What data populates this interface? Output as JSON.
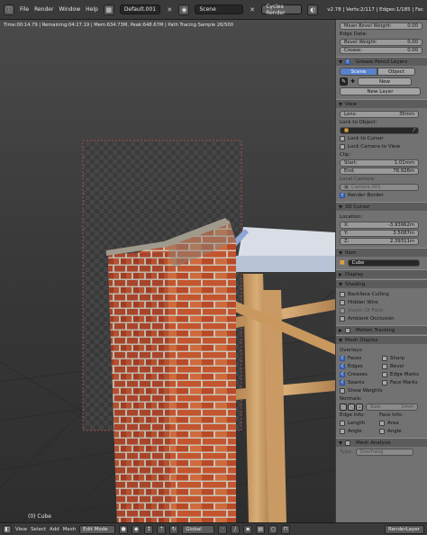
{
  "topbar": {
    "menus": [
      "File",
      "Render",
      "Window",
      "Help"
    ],
    "screen_layout": "Default.001",
    "scene": "Scene",
    "render_engine": "Cycles Render",
    "stats": "v2.78 | Verts:2/117 | Edges:1/185 | Fac"
  },
  "viewport": {
    "status_line": "Time:00:14.79 | Remaining:04:27.19 | Mem:634.73M, Peak:648.67M | Path Tracing Sample 26/500",
    "object_name": "(0) Cube"
  },
  "sidebar": {
    "mean_bevel_weight": "Mean Bevel Weight:",
    "mean_bevel_weight_val": "0.00",
    "edge_data": "Edge Data:",
    "bevel_weight": "Bevel Weight:",
    "bevel_weight_val": "0.00",
    "crease": "Crease:",
    "crease_val": "0.00",
    "grease_pencil": {
      "title": "Grease Pencil Layers",
      "tab_scene": "Scene",
      "tab_object": "Object",
      "new_label": "New",
      "new_layer": "New Layer"
    },
    "view": {
      "title": "View",
      "lens_label": "Lens:",
      "lens_value": "35mm",
      "lock_to_object": "Lock to Object:",
      "lock_to_cursor": "Lock to Cursor",
      "lock_camera": "Lock Camera to View",
      "clip": "Clip:",
      "start_label": "Start:",
      "start_value": "1.01mm",
      "end_label": "End:",
      "end_value": "78.926m",
      "local_camera": "Local Camera:",
      "camera_name": "Camera.001",
      "render_border": "Render Border"
    },
    "cursor": {
      "title": "3D Cursor",
      "location": "Location:",
      "x_label": "X:",
      "x_value": "-3.93962m",
      "y_label": "Y:",
      "y_value": "3.5087m",
      "z_label": "Z:",
      "z_value": "2.39311m"
    },
    "item": {
      "title": "Item",
      "name": "Cube"
    },
    "display": {
      "title": "Display"
    },
    "shading": {
      "title": "Shading",
      "backface": "Backface Culling",
      "hidden_wire": "Hidden Wire",
      "depth_field": "Depth Of Field",
      "ambient": "Ambient Occlusion"
    },
    "motion_tracking": {
      "title": "Motion Tracking"
    },
    "mesh_display": {
      "title": "Mesh Display",
      "overlays": "Overlays:",
      "faces": "Faces",
      "edges": "Edges",
      "creases": "Creases",
      "seams": "Seams",
      "sharp": "Sharp",
      "bevel": "Bevel",
      "edge_marks": "Edge Marks",
      "face_marks": "Face Marks",
      "show_weights": "Show Weights",
      "normals": "Normals:",
      "size_label": "Size:",
      "size_value": "1mm",
      "edge_info": "Edge Info:",
      "face_info": "Face Info:",
      "length": "Length",
      "area": "Area",
      "angle_e": "Angle",
      "angle_f": "Angle"
    },
    "mesh_analysis": {
      "title": "Mesh Analysis",
      "type_label": "Type:",
      "type_value": "Overhang"
    }
  },
  "bottombar": {
    "view": "View",
    "select": "Select",
    "add": "Add",
    "mesh": "Mesh",
    "mode": "Edit Mode",
    "pivot": "Global",
    "render_layer": "RenderLayer"
  },
  "colors": {
    "accent_blue": "#5a82cc",
    "sidebar_bg": "#727272",
    "header_bg": "#3a3a3a"
  }
}
